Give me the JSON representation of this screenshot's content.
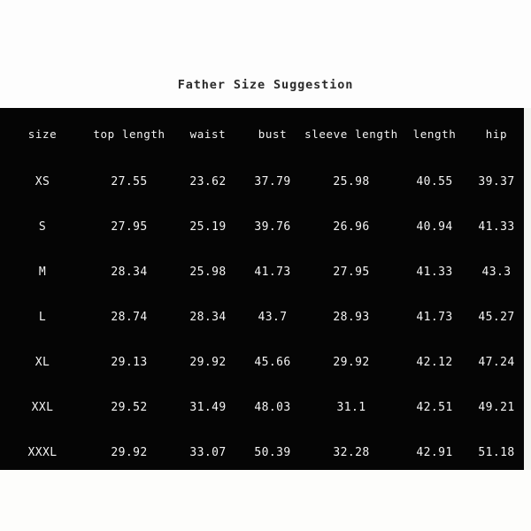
{
  "title": "Father Size Suggestion",
  "colors": {
    "page_background": "#fdfdfd",
    "panel_background": "#050505",
    "text_on_panel": "#f4f4f4",
    "title_text": "#2b2b2b"
  },
  "table": {
    "columns": [
      {
        "key": "size",
        "label": "size"
      },
      {
        "key": "top_length",
        "label": "top length"
      },
      {
        "key": "waist",
        "label": "waist"
      },
      {
        "key": "bust",
        "label": "bust"
      },
      {
        "key": "sleeve_length",
        "label": "sleeve length"
      },
      {
        "key": "length",
        "label": "length"
      },
      {
        "key": "hip",
        "label": "hip"
      }
    ],
    "rows": [
      {
        "size": "XS",
        "top_length": "27.55",
        "waist": "23.62",
        "bust": "37.79",
        "sleeve_length": "25.98",
        "length": "40.55",
        "hip": "39.37"
      },
      {
        "size": "S",
        "top_length": "27.95",
        "waist": "25.19",
        "bust": "39.76",
        "sleeve_length": "26.96",
        "length": "40.94",
        "hip": "41.33"
      },
      {
        "size": "M",
        "top_length": "28.34",
        "waist": "25.98",
        "bust": "41.73",
        "sleeve_length": "27.95",
        "length": "41.33",
        "hip": "43.3"
      },
      {
        "size": "L",
        "top_length": "28.74",
        "waist": "28.34",
        "bust": "43.7",
        "sleeve_length": "28.93",
        "length": "41.73",
        "hip": "45.27"
      },
      {
        "size": "XL",
        "top_length": "29.13",
        "waist": "29.92",
        "bust": "45.66",
        "sleeve_length": "29.92",
        "length": "42.12",
        "hip": "47.24"
      },
      {
        "size": "XXL",
        "top_length": "29.52",
        "waist": "31.49",
        "bust": "48.03",
        "sleeve_length": "31.1",
        "length": "42.51",
        "hip": "49.21"
      },
      {
        "size": "XXXL",
        "top_length": "29.92",
        "waist": "33.07",
        "bust": "50.39",
        "sleeve_length": "32.28",
        "length": "42.91",
        "hip": "51.18"
      }
    ]
  }
}
